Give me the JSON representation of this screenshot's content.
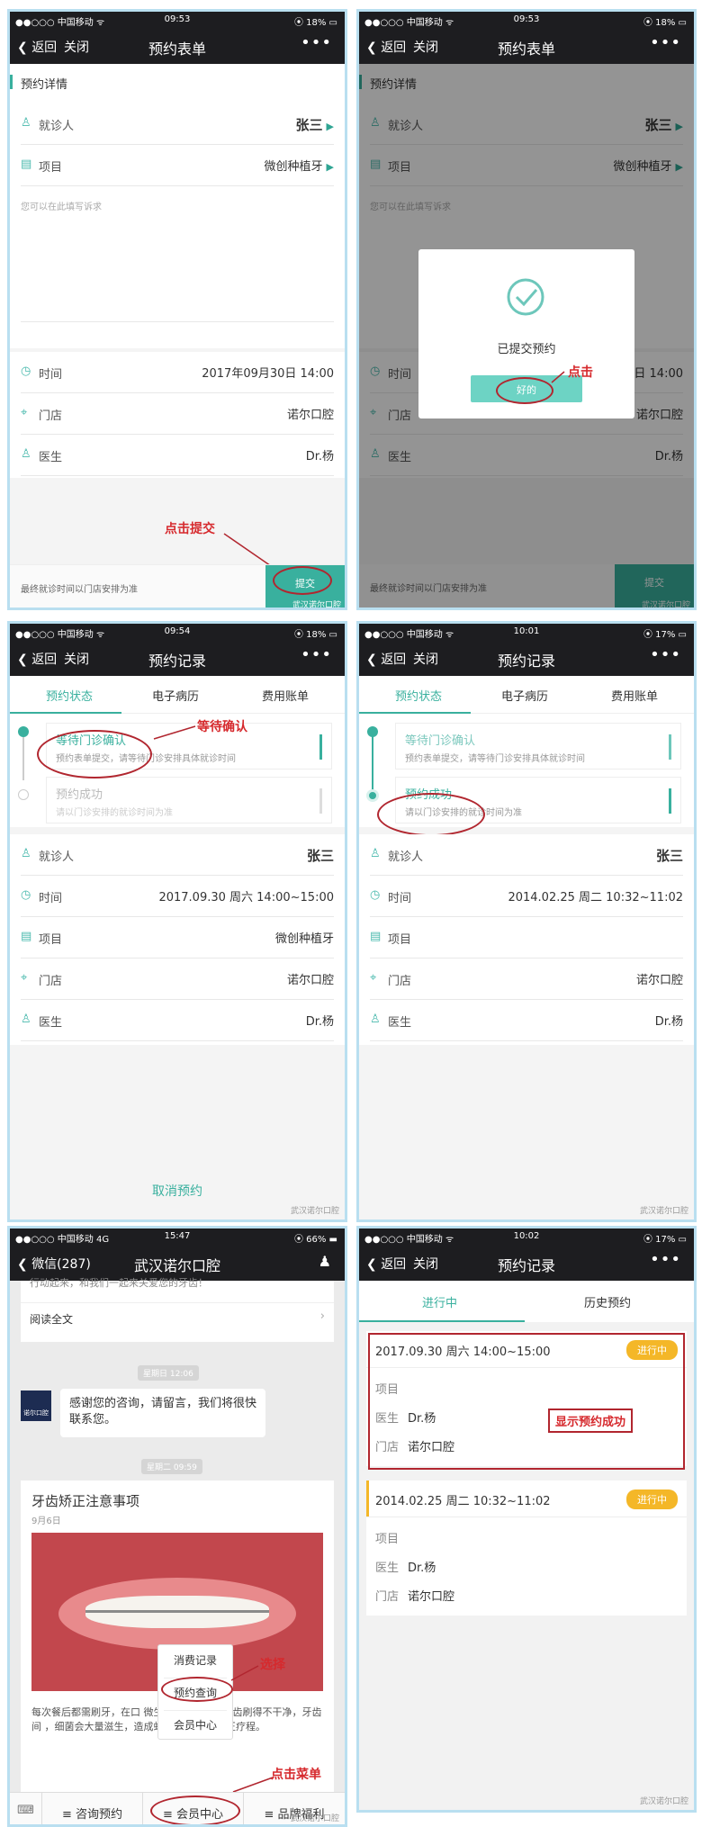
{
  "status_bars": [
    {
      "carrier": "●●○○○ 中国移动 ᯤ",
      "time": "09:53",
      "battery": "⦿ 18% ▭"
    },
    {
      "carrier": "●●○○○ 中国移动 ᯤ",
      "time": "09:53",
      "battery": "⦿ 18% ▭"
    },
    {
      "carrier": "●●○○○ 中国移动 ᯤ",
      "time": "09:54",
      "battery": "⦿ 18% ▭"
    },
    {
      "carrier": "●●○○○ 中国移动 ᯤ",
      "time": "10:01",
      "battery": "⦿ 17% ▭"
    },
    {
      "carrier": "●●○○○ 中国移动 4G",
      "time": "15:47",
      "battery": "⦿ 66% ▬"
    },
    {
      "carrier": "●●○○○ 中国移动 ᯤ",
      "time": "10:02",
      "battery": "⦿ 17% ▭"
    }
  ],
  "nav": {
    "back": "返回",
    "close": "关闭",
    "more": "•••",
    "form_title": "预约表单",
    "record_title": "预约记录"
  },
  "form": {
    "section_title": "预约详情",
    "patient_label": "就诊人",
    "patient_value": "张三",
    "project_label": "项目",
    "project_value": "微创种植牙",
    "note_placeholder": "您可以在此填写诉求",
    "time_label": "时间",
    "time_value": "2017年09月30日 14:00",
    "store_label": "门店",
    "store_value": "诺尔口腔",
    "doctor_label": "医生",
    "doctor_value": "Dr.杨",
    "footer_note": "最终就诊时间以门店安排为准",
    "submit": "提交",
    "watermark": "武汉诺尔口腔"
  },
  "dialog": {
    "message": "已提交预约",
    "ok": "好的"
  },
  "annotations": {
    "click_submit": "点击提交",
    "click": "点击",
    "waiting": "等待确认",
    "select": "选择",
    "click_menu": "点击菜单",
    "show_success": "显示预约成功"
  },
  "record": {
    "tabs": [
      "预约状态",
      "电子病历",
      "费用账单"
    ],
    "step1_title": "等待门诊确认",
    "step1_sub": "预约表单提交，请等待门诊安排具体就诊时间",
    "step2_title": "预约成功",
    "step2_sub": "请以门诊安排的就诊时间为准",
    "patient_label": "就诊人",
    "patient_value": "张三",
    "time_label": "时间",
    "time_value_a": "2017.09.30 周六 14:00~15:00",
    "time_value_b": "2014.02.25 周二 10:32~11:02",
    "project_label": "项目",
    "project_value": "微创种植牙",
    "store_label": "门店",
    "store_value": "诺尔口腔",
    "doctor_label": "医生",
    "doctor_value": "Dr.杨",
    "cancel": "取消预约",
    "watermark": "武汉诺尔口腔"
  },
  "wechat": {
    "back": "微信(287)",
    "title": "武汉诺尔口腔",
    "top_text": "行动起来，和我们一起来关爱您的牙齿！",
    "read_full": "阅读全文",
    "time1": "星期日 12:06",
    "msg": "感谢您的咨询，请留言，我们将很快联系您。",
    "avatar_text": "诺尔口腔",
    "time2": "星期二 09:59",
    "article_title": "牙齿矫正注意事项",
    "article_date": "9月6日",
    "article_body": "每次餐后都需刷牙，在口 微生物存在，如果牙齿刷得不干净，牙齿间 ，细菌会大量滋生，造成蛀牙或牙周炎症 正疗程。",
    "menu_items": [
      "消费记录",
      "预约查询",
      "会员中心"
    ],
    "bottom_menu": [
      "咨询预约",
      "会员中心",
      "品牌福利"
    ],
    "watermark": "武汉诺尔口腔"
  },
  "list": {
    "tabs": [
      "进行中",
      "历史预约"
    ],
    "c1_date": "2017.09.30 周六 14:00~15:00",
    "c1_badge": "进行中",
    "c2_date": "2014.02.25 周二 10:32~11:02",
    "c2_badge": "进行中",
    "project_label": "项目",
    "doctor_label": "医生",
    "doctor_value": "Dr.杨",
    "store_label": "门店",
    "store_value": "诺尔口腔",
    "watermark": "武汉诺尔口腔"
  }
}
